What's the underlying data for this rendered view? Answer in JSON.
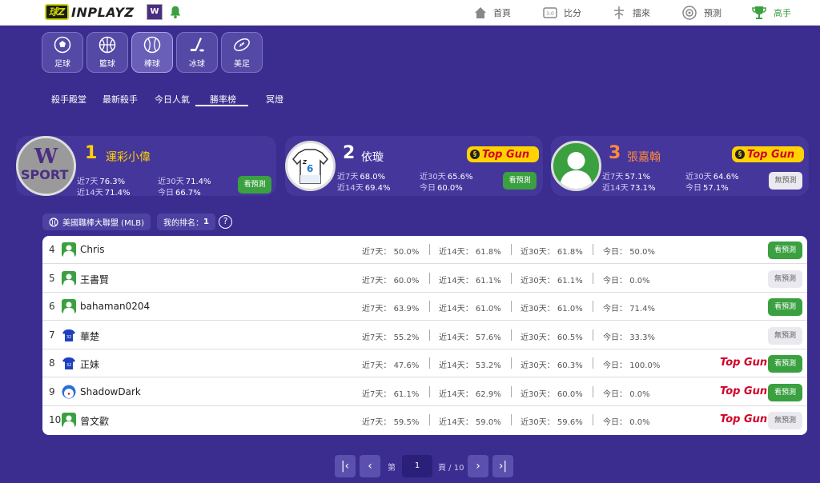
{
  "brand": {
    "logo_mark": "球Z",
    "logo_text": "INPLAYZ",
    "avatar_text": "W"
  },
  "nav": [
    {
      "label": "首頁",
      "icon": "home-icon"
    },
    {
      "label": "比分",
      "icon": "scoreboard-icon"
    },
    {
      "label": "擂來",
      "icon": "arena-icon"
    },
    {
      "label": "預測",
      "icon": "target-icon"
    },
    {
      "label": "高手",
      "icon": "trophy-icon"
    }
  ],
  "sports": [
    {
      "label": "足球",
      "icon": "soccer-ball-icon"
    },
    {
      "label": "籃球",
      "icon": "basketball-icon"
    },
    {
      "label": "棒球",
      "icon": "baseball-icon"
    },
    {
      "label": "冰球",
      "icon": "hockey-icon"
    },
    {
      "label": "美足",
      "icon": "football-icon"
    }
  ],
  "subtabs": [
    "殺手殿堂",
    "最新殺手",
    "今日人氣",
    "勝率榜",
    "冥燈"
  ],
  "podium": [
    {
      "rank": "1",
      "name": "運彩小偉",
      "img_text": "W",
      "img_text2": "SPORT",
      "d7": "76.3%",
      "d14": "71.4%",
      "d30": "71.4%",
      "today": "66.7%",
      "button": "看預測",
      "topgun": ""
    },
    {
      "rank": "2",
      "name": "依璇",
      "jersey_num": "6",
      "d7": "68.0%",
      "d14": "69.4%",
      "d30": "65.6%",
      "today": "60.0%",
      "button": "看預測",
      "topgun": "Top Gun"
    },
    {
      "rank": "3",
      "name": "張嘉翰",
      "d7": "57.1%",
      "d14": "73.1%",
      "d30": "64.6%",
      "today": "57.1%",
      "button": "無預測",
      "topgun": "Top Gun"
    }
  ],
  "labels": {
    "d7": "近7天",
    "d14": "近14天",
    "d30": "近30天",
    "today": "今日",
    "d7c": "近7天：",
    "d14c": "近14天：",
    "d30c": "近30天：",
    "todayc": "今日："
  },
  "filters": {
    "league": "美國職棒大聯盟 (MLB)",
    "my_rank_label": "我的排名：",
    "my_rank": "1",
    "help": "?"
  },
  "rows": [
    {
      "rank": "4",
      "name": "Chris",
      "avatar": "green",
      "d7": "50.0%",
      "d14": "61.8%",
      "d30": "61.8%",
      "today": "50.0%",
      "topgun": "",
      "button": "看預測",
      "has": true
    },
    {
      "rank": "5",
      "name": "王書賢",
      "avatar": "green",
      "d7": "60.0%",
      "d14": "61.1%",
      "d30": "61.1%",
      "today": "0.0%",
      "topgun": "",
      "button": "無預測",
      "has": false
    },
    {
      "rank": "6",
      "name": "bahaman0204",
      "avatar": "green",
      "d7": "63.9%",
      "d14": "61.0%",
      "d30": "61.0%",
      "today": "71.4%",
      "topgun": "",
      "button": "看預測",
      "has": true
    },
    {
      "rank": "7",
      "name": "華楚",
      "avatar": "jersey",
      "d7": "55.2%",
      "d14": "57.6%",
      "d30": "60.5%",
      "today": "33.3%",
      "topgun": "",
      "button": "無預測",
      "has": false
    },
    {
      "rank": "8",
      "name": "正妹",
      "avatar": "jersey",
      "d7": "47.6%",
      "d14": "53.2%",
      "d30": "60.3%",
      "today": "100.0%",
      "topgun": "Top Gun",
      "button": "看預測",
      "has": true
    },
    {
      "rank": "9",
      "name": "ShadowDark",
      "avatar": "robot",
      "d7": "61.1%",
      "d14": "62.9%",
      "d30": "60.0%",
      "today": "0.0%",
      "topgun": "Top Gun",
      "button": "看預測",
      "has": true
    },
    {
      "rank": "10",
      "name": "曾文歡",
      "avatar": "green",
      "d7": "59.5%",
      "d14": "59.0%",
      "d30": "59.6%",
      "today": "0.0%",
      "topgun": "Top Gun",
      "button": "無預測",
      "has": false
    }
  ],
  "pagination": {
    "first": "|‹",
    "prev": "‹",
    "page_label": "第",
    "page": "1",
    "total": "頁 / 10",
    "next": "›",
    "last": "›|"
  },
  "colors": {
    "bg": "#3a2d8f",
    "accent_green": "#3aa040",
    "topgun_red": "#d10026",
    "topgun_yellow": "#ffd200"
  }
}
